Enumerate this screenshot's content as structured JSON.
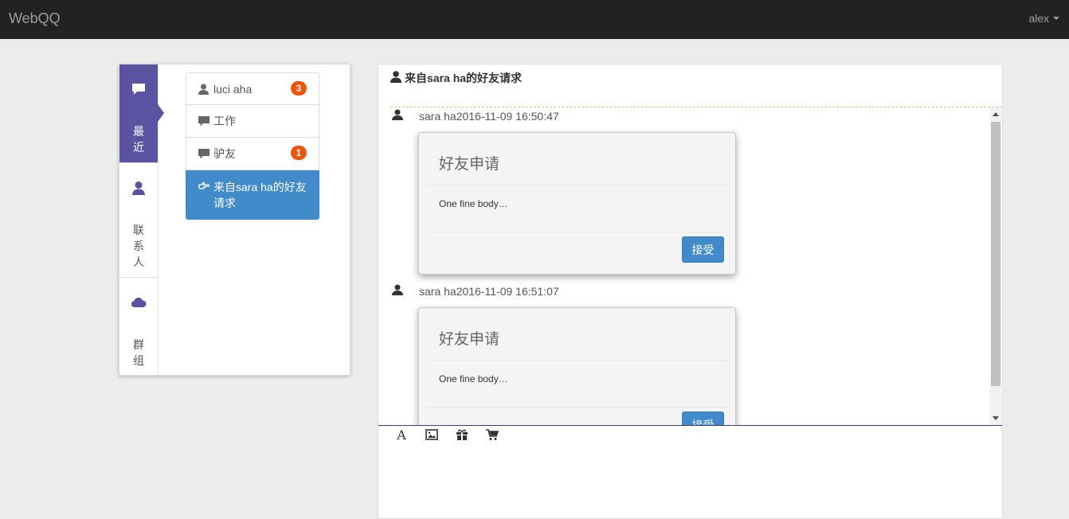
{
  "navbar": {
    "brand": "WebQQ",
    "user": "alex"
  },
  "side_tabs": [
    {
      "label": "最近",
      "icon": "comment-icon",
      "active": true
    },
    {
      "label": "联系人",
      "icon": "user-icon",
      "active": false
    },
    {
      "label": "群组",
      "icon": "cloud-icon",
      "active": false
    }
  ],
  "conversations": [
    {
      "name": "luci aha",
      "icon": "user-icon",
      "badge": "3"
    },
    {
      "name": "工作",
      "icon": "comment-icon",
      "badge": ""
    },
    {
      "name": "驴友",
      "icon": "comment-icon",
      "badge": "1"
    },
    {
      "name": "来自sara ha的好友请求",
      "icon": "hand-right-icon",
      "badge": "",
      "active": true
    }
  ],
  "chat": {
    "title": "来自sara ha的好友请求",
    "messages": [
      {
        "sender": "sara ha",
        "time": "2016-11-09 16:50:47",
        "card_title": "好友申请",
        "card_body": "One fine body…",
        "button": "接受"
      },
      {
        "sender": "sara ha",
        "time": "2016-11-09 16:51:07",
        "card_title": "好友申请",
        "card_body": "One fine body…",
        "button": "接受"
      }
    ],
    "toolbar": [
      "font-icon",
      "picture-icon",
      "gift-icon",
      "cart-icon"
    ],
    "composer_value": ""
  },
  "colors": {
    "navbar_bg": "#222222",
    "tab_active": "#5b53a2",
    "list_active": "#428bca",
    "badge": "#f0530a",
    "button": "#428bca"
  }
}
